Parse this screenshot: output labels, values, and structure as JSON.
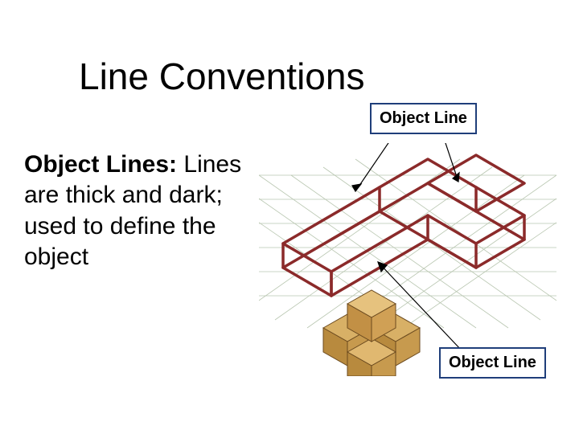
{
  "title": "Line Conventions",
  "labels": {
    "top": "Object Line",
    "bottom": "Object Line"
  },
  "body": {
    "heading": "Object Lines:",
    "text": "Lines are thick and dark; used to define the object"
  }
}
